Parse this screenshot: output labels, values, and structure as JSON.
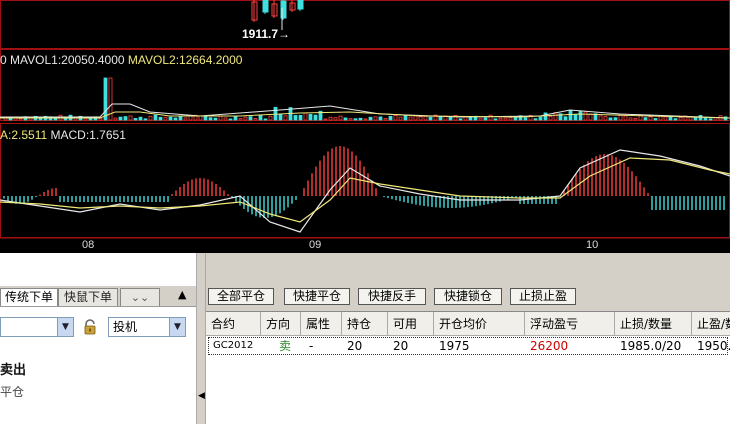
{
  "chart": {
    "price_label": "1911.7→",
    "vol_legend": {
      "prefix": "0",
      "mavol1": "MAVOL1:20050.4000",
      "mavol2": "MAVOL2:12664.2000"
    },
    "macd_legend": {
      "dea": "A:2.5511",
      "macd": "MACD:1.7651"
    },
    "date_ticks": [
      "08",
      "09",
      "10"
    ],
    "colors": {
      "pane_border": "#a01010",
      "up": "#ff4040",
      "down": "#40e0e0",
      "line_white": "#e8e8e8",
      "line_yellow": "#f0e87a"
    }
  },
  "left_panel": {
    "tabs": [
      "传统下单",
      "快鼠下单"
    ],
    "active_tab": "传统下单",
    "dropdown_glyph": "⌄⌄",
    "collapse_glyph": "▲",
    "contract_value": "",
    "order_type": "投机",
    "action_title": "卖出",
    "action_sub": "平仓"
  },
  "toolbar": {
    "buttons": [
      "全部平仓",
      "快捷平仓",
      "快捷反手",
      "快捷锁仓",
      "止损止盈"
    ]
  },
  "positions": {
    "columns": [
      "合约",
      "方向",
      "属性",
      "持仓",
      "可用",
      "开仓均价",
      "浮动盈亏",
      "止损/数量",
      "止盈/数"
    ],
    "rows": [
      {
        "contract": "GC2012",
        "direction": "卖",
        "attribute": "-",
        "holding": "20",
        "available": "20",
        "avg_price": "1975",
        "float_pnl": "26200",
        "stop_loss": "1985.0/20",
        "take_profit": "1950."
      }
    ],
    "colors": {
      "direction": "#2a8a2a",
      "pnl": "#cc0000"
    }
  }
}
